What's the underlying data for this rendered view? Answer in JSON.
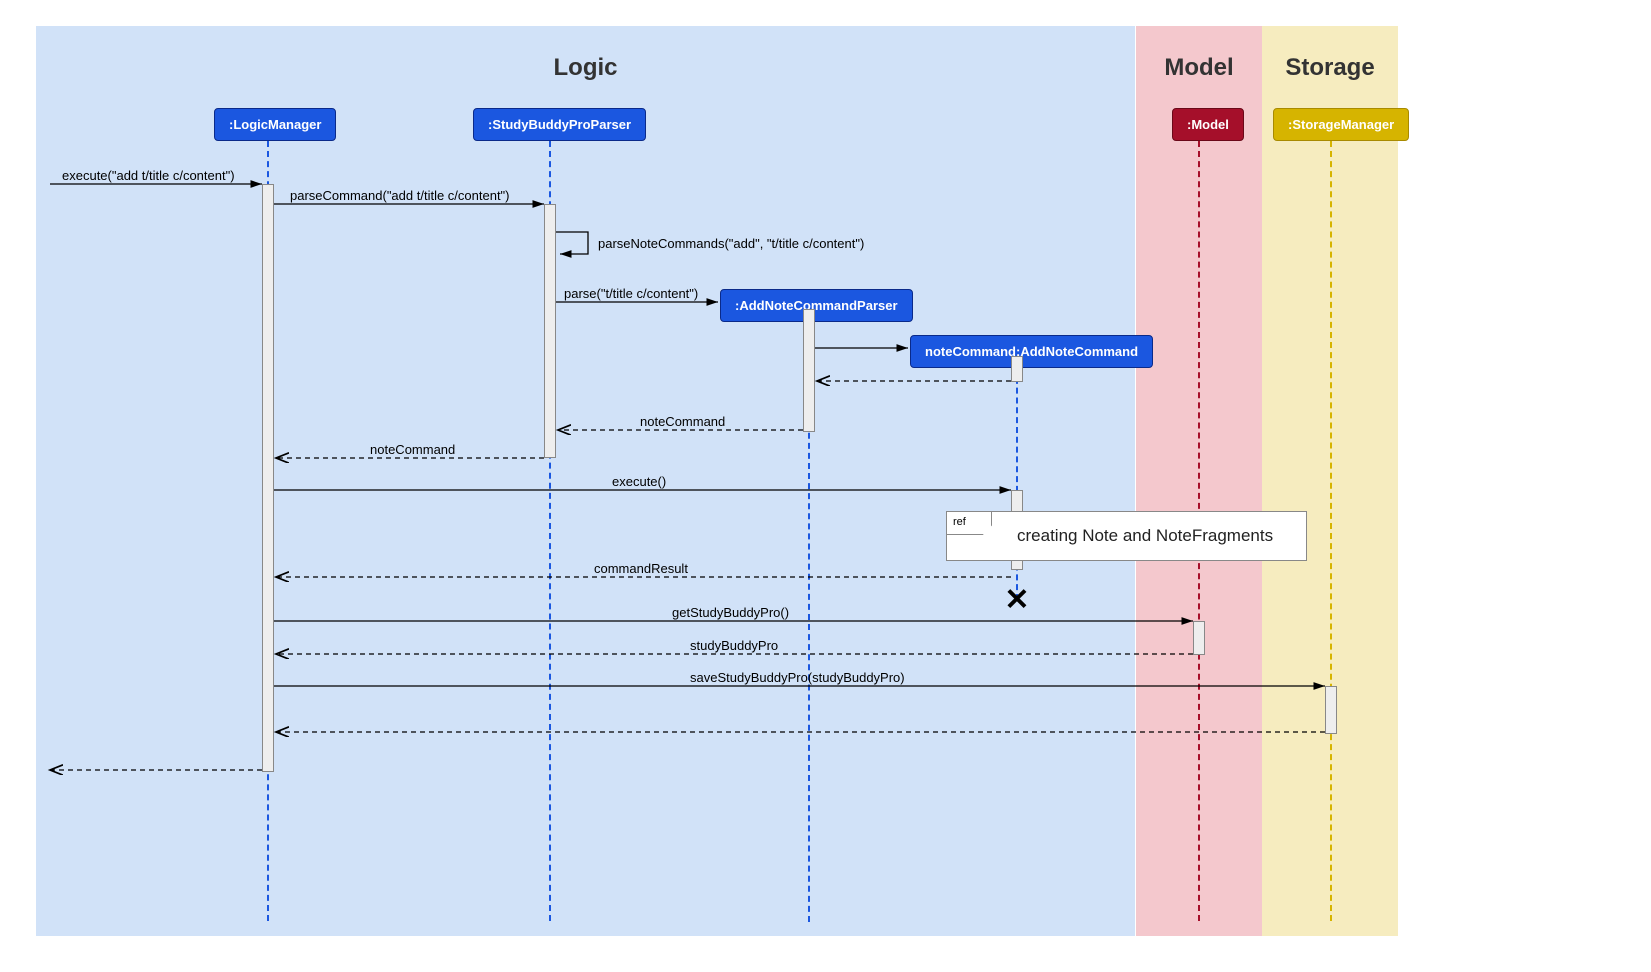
{
  "regions": {
    "logic": "Logic",
    "model": "Model",
    "storage": "Storage"
  },
  "participants": {
    "logicManager": ":LogicManager",
    "parser": ":StudyBuddyProParser",
    "addNoteCmdParser": ":AddNoteCommandParser",
    "addNoteCmd": "noteCommand:AddNoteCommand",
    "model": ":Model",
    "storage": ":StorageManager"
  },
  "messages": {
    "execute_in": "execute(\"add t/title c/content\")",
    "parseCommand": "parseCommand(\"add t/title c/content\")",
    "parseNoteCommands": "parseNoteCommands(\"add\", \"t/title c/content\")",
    "parse": "parse(\"t/title c/content\")",
    "noteCommand_ret1": "noteCommand",
    "noteCommand_ret2": "noteCommand",
    "executeCmd": "execute()",
    "commandResult": "commandResult",
    "getStudyBuddyPro": "getStudyBuddyPro()",
    "studyBuddyPro": "studyBuddyPro",
    "saveStudyBuddyPro": "saveStudyBuddyPro(studyBuddyPro)"
  },
  "ref": {
    "label": "ref",
    "text": "creating Note and NoteFragments"
  }
}
